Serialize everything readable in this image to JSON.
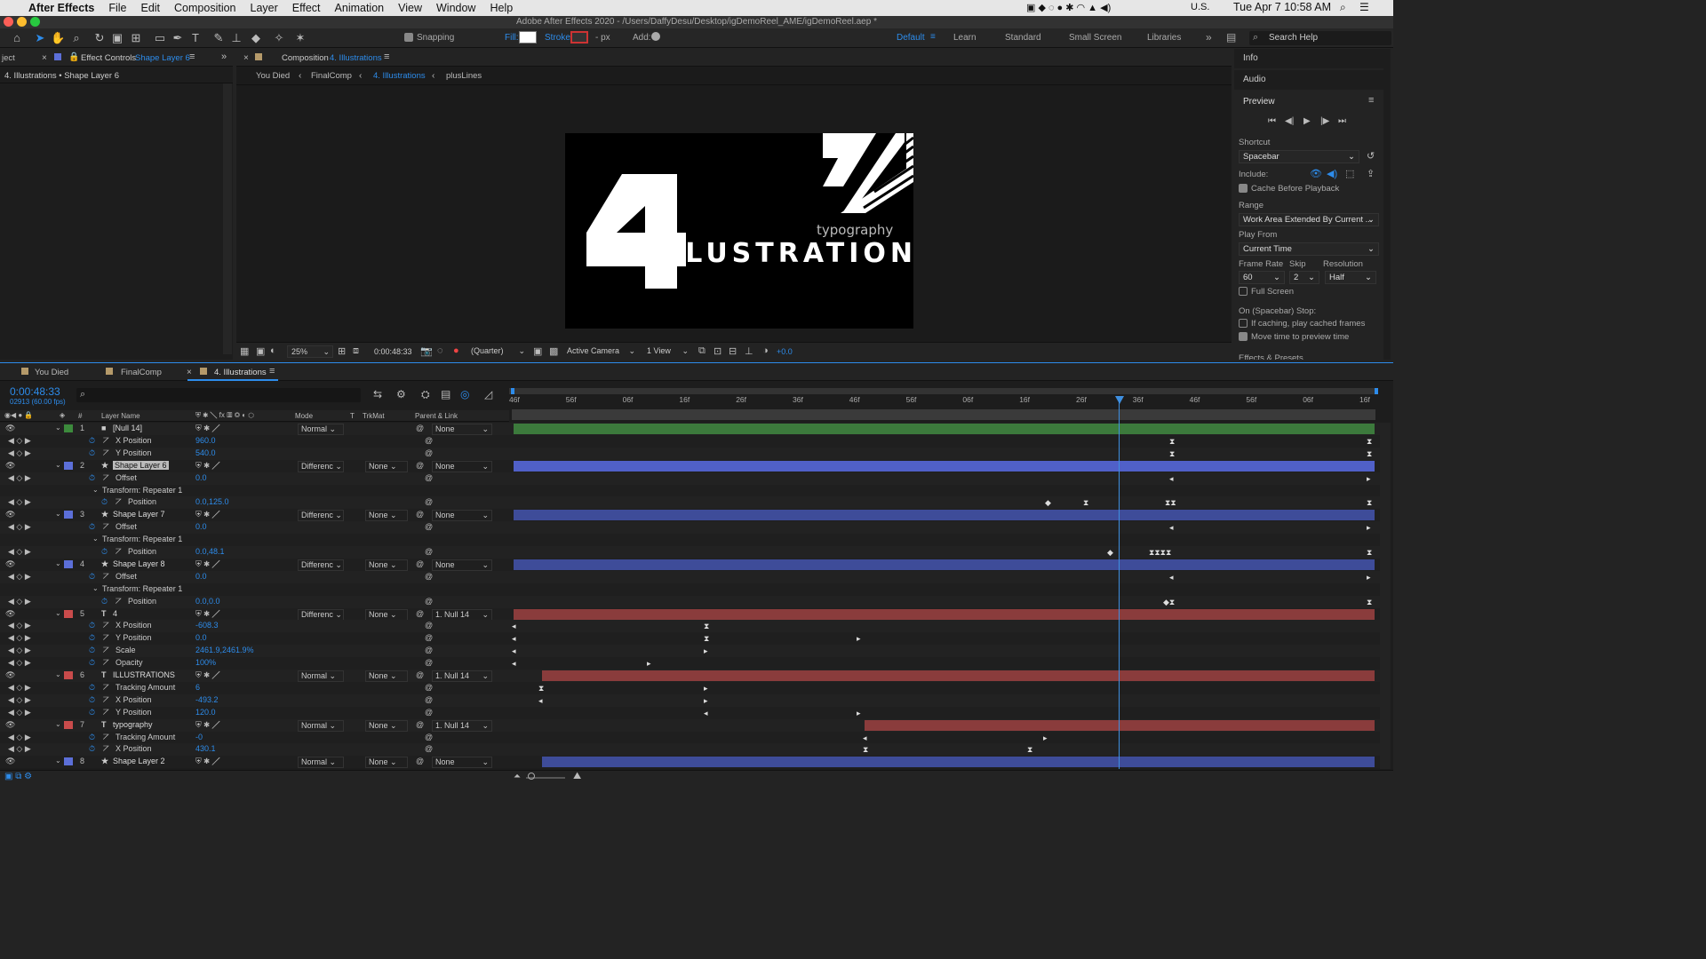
{
  "menubar": {
    "app": "After Effects",
    "items": [
      "File",
      "Edit",
      "Composition",
      "Layer",
      "Effect",
      "Animation",
      "View",
      "Window",
      "Help"
    ],
    "locale": "U.S.",
    "datetime": "Tue Apr 7  10:58 AM"
  },
  "window_title": "Adobe After Effects 2020 - /Users/DaffyDesu/Desktop/igDemoReel_AME/igDemoReel.aep *",
  "toolbar": {
    "snapping": "Snapping",
    "fill": "Fill:",
    "stroke": "Stroke:",
    "px": "- px",
    "add": "Add:",
    "workspaces": [
      "Default",
      "Learn",
      "Standard",
      "Small Screen",
      "Libraries"
    ],
    "search": "Search Help"
  },
  "left_panel": {
    "project_tab": "ject",
    "effect_tab": "Effect Controls",
    "effect_layer": "Shape Layer 6",
    "header": "4. Illustrations • Shape Layer 6"
  },
  "comp_panel": {
    "tab_label": "Composition",
    "tab_name": "4. Illustrations",
    "breadcrumbs": [
      "You Died",
      "FinalComp",
      "4. Illustrations",
      "plusLines"
    ],
    "zoom": "25%",
    "timecode": "0:00:48:33",
    "quality": "(Quarter)",
    "camera": "Active Camera",
    "view": "1 View",
    "exposure": "+0.0"
  },
  "artwork": {
    "big_number": "4",
    "word": "ILLUSTRATIONS",
    "sub": "typography"
  },
  "right_panel": {
    "info": "Info",
    "audio": "Audio",
    "preview": "Preview",
    "shortcut_label": "Shortcut",
    "shortcut": "Spacebar",
    "include": "Include:",
    "cache": "Cache Before Playback",
    "range_label": "Range",
    "range": "Work Area Extended By Current ...",
    "playfrom_label": "Play From",
    "playfrom": "Current Time",
    "framerate_label": "Frame Rate",
    "skip_label": "Skip",
    "resolution_label": "Resolution",
    "framerate": "60",
    "skip": "2",
    "resolution": "Half",
    "fullscreen": "Full Screen",
    "stop_label": "On (Spacebar) Stop:",
    "stop1": "If caching, play cached frames",
    "stop2": "Move time to preview time",
    "effects": "Effects & Presets"
  },
  "timeline": {
    "tabs": [
      "You Died",
      "FinalComp",
      "4. Illustrations"
    ],
    "timecode": "0:00:48:33",
    "fps": "02913 (60.00 fps)",
    "headers": {
      "num": "#",
      "name": "Layer Name",
      "mode": "Mode",
      "t": "T",
      "trkmat": "TrkMat",
      "parent": "Parent & Link"
    },
    "ruler": [
      "46f",
      "56f",
      "06f",
      "16f",
      "26f",
      "36f",
      "46f",
      "56f",
      "06f",
      "16f",
      "26f",
      "36f",
      "46f",
      "56f",
      "06f",
      "16f"
    ],
    "rows": [
      {
        "kind": "layer",
        "num": "1",
        "name": "[Null 14]",
        "label": "#3c8a3c",
        "mode": "Normal",
        "trk": "",
        "parent": "None",
        "bar": "#3c7a3c",
        "barStart": 0,
        "icon": "square"
      },
      {
        "kind": "prop",
        "name": "X Position",
        "value": "960.0",
        "indent": 1
      },
      {
        "kind": "prop",
        "name": "Y Position",
        "value": "540.0",
        "indent": 1
      },
      {
        "kind": "layer",
        "num": "2",
        "name": "Shape Layer 6",
        "label": "#5c6fd8",
        "mode": "Differenc",
        "trk": "None",
        "parent": "None",
        "bar": "#5060c8",
        "barStart": 0,
        "icon": "star",
        "selected": true
      },
      {
        "kind": "prop",
        "name": "Offset",
        "value": "0.0",
        "indent": 1
      },
      {
        "kind": "group",
        "name": "Transform: Repeater 1"
      },
      {
        "kind": "prop",
        "name": "Position",
        "value": "0.0,125.0",
        "indent": 2
      },
      {
        "kind": "layer",
        "num": "3",
        "name": "Shape Layer 7",
        "label": "#5c6fd8",
        "mode": "Differenc",
        "trk": "None",
        "parent": "None",
        "bar": "#3e4c99",
        "barStart": 0,
        "icon": "star"
      },
      {
        "kind": "prop",
        "name": "Offset",
        "value": "0.0",
        "indent": 1
      },
      {
        "kind": "group",
        "name": "Transform: Repeater 1"
      },
      {
        "kind": "prop",
        "name": "Position",
        "value": "0.0,48.1",
        "indent": 2
      },
      {
        "kind": "layer",
        "num": "4",
        "name": "Shape Layer 8",
        "label": "#5c6fd8",
        "mode": "Differenc",
        "trk": "None",
        "parent": "None",
        "bar": "#3e4c99",
        "barStart": 0,
        "icon": "star"
      },
      {
        "kind": "prop",
        "name": "Offset",
        "value": "0.0",
        "indent": 1
      },
      {
        "kind": "group",
        "name": "Transform: Repeater 1"
      },
      {
        "kind": "prop",
        "name": "Position",
        "value": "0.0,0.0",
        "indent": 2
      },
      {
        "kind": "layer",
        "num": "5",
        "name": "4",
        "label": "#c94b4b",
        "mode": "Differenc",
        "trk": "None",
        "parent": "1. Null 14",
        "bar": "#8a3c3c",
        "barStart": 0,
        "icon": "T"
      },
      {
        "kind": "prop",
        "name": "X Position",
        "value": "-608.3",
        "indent": 1
      },
      {
        "kind": "prop",
        "name": "Y Position",
        "value": "0.0",
        "indent": 1
      },
      {
        "kind": "prop",
        "name": "Scale",
        "value": "2461.9,2461.9%",
        "indent": 1
      },
      {
        "kind": "prop",
        "name": "Opacity",
        "value": "100%",
        "indent": 1
      },
      {
        "kind": "layer",
        "num": "6",
        "name": "ILLUSTRATIONS",
        "label": "#c94b4b",
        "mode": "Normal",
        "trk": "None",
        "parent": "1. Null 14",
        "bar": "#8a3c3c",
        "barStart": 32,
        "icon": "T"
      },
      {
        "kind": "prop",
        "name": "Tracking Amount",
        "value": "6",
        "indent": 1
      },
      {
        "kind": "prop",
        "name": "X Position",
        "value": "-493.2",
        "indent": 1
      },
      {
        "kind": "prop",
        "name": "Y Position",
        "value": "120.0",
        "indent": 1
      },
      {
        "kind": "layer",
        "num": "7",
        "name": "typography",
        "label": "#c94b4b",
        "mode": "Normal",
        "trk": "None",
        "parent": "1. Null 14",
        "bar": "#8a3c3c",
        "barStart": 395,
        "icon": "T"
      },
      {
        "kind": "prop",
        "name": "Tracking Amount",
        "value": "-0",
        "indent": 1
      },
      {
        "kind": "prop",
        "name": "X Position",
        "value": "430.1",
        "indent": 1
      },
      {
        "kind": "layer",
        "num": "8",
        "name": "Shape Layer 2",
        "label": "#5c6fd8",
        "mode": "Normal",
        "trk": "None",
        "parent": "None",
        "bar": "#3e4c99",
        "barStart": 32,
        "icon": "star"
      }
    ]
  }
}
